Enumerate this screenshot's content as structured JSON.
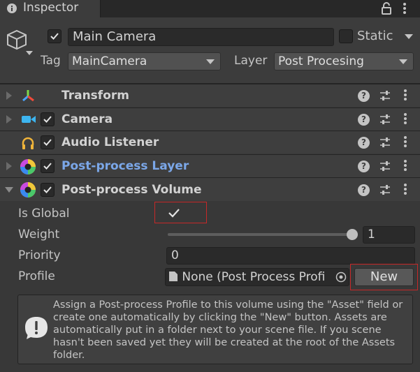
{
  "window": {
    "tab_label": "Inspector"
  },
  "header": {
    "object_name": "Main Camera",
    "static_label": "Static",
    "tag_label": "Tag",
    "tag_value": "MainCamera",
    "layer_label": "Layer",
    "layer_value": "Post Procesing"
  },
  "components": [
    {
      "label": "Transform"
    },
    {
      "label": "Camera"
    },
    {
      "label": "Audio Listener"
    },
    {
      "label": "Post-process Layer"
    },
    {
      "label": "Post-process Volume"
    }
  ],
  "volume": {
    "is_global_label": "Is Global",
    "weight_label": "Weight",
    "weight_value": "1",
    "weight_fraction": 1.0,
    "priority_label": "Priority",
    "priority_value": "0",
    "profile_label": "Profile",
    "profile_value": "None (Post Process Profi",
    "new_button": "New"
  },
  "helpbox": {
    "text": "Assign a Post-process Profile to this volume using the \"Asset\" field or create one automatically by clicking the \"New\" button. Assets are automatically put in a folder next to your scene file. If you scene hasn't been saved yet they will be created at the root of the Assets folder."
  },
  "colors": {
    "background": "#383838",
    "highlight_label": "#7ba7e8",
    "annotation_red": "#c62828"
  }
}
